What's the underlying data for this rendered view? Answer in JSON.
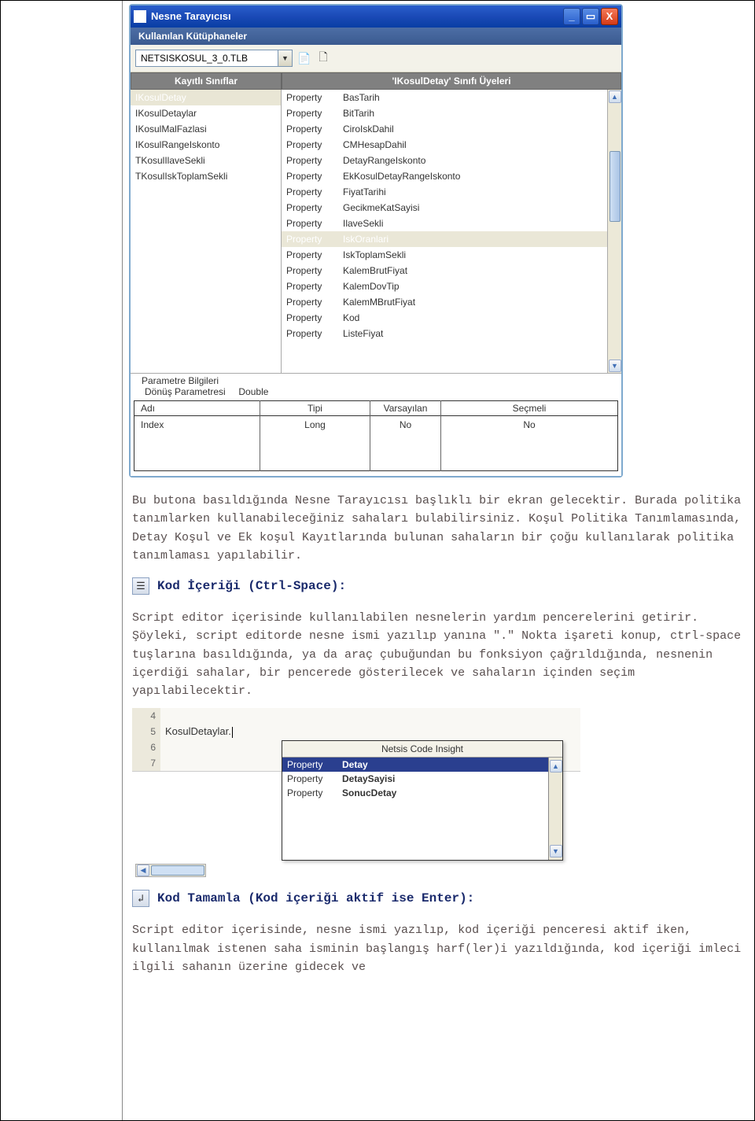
{
  "window": {
    "title": "Nesne Tarayıcısı",
    "subheader": "Kullanılan Kütüphaneler",
    "library_value": "NETSISKOSUL_3_0.TLB",
    "left_col_title": "Kayıtlı Sınıflar",
    "right_col_title": "'IKosulDetay' Sınıfı Üyeleri"
  },
  "classes": [
    {
      "name": "IKosulDetay",
      "selected": true
    },
    {
      "name": "IKosulDetaylar"
    },
    {
      "name": "IKosulMalFazlasi"
    },
    {
      "name": "IKosulRangeIskonto"
    },
    {
      "name": "TKosulIlaveSekli"
    },
    {
      "name": "TKosulIskToplamSekli"
    }
  ],
  "members": [
    {
      "kind": "Property",
      "name": "BasTarih"
    },
    {
      "kind": "Property",
      "name": "BitTarih"
    },
    {
      "kind": "Property",
      "name": "CiroIskDahil"
    },
    {
      "kind": "Property",
      "name": "CMHesapDahil"
    },
    {
      "kind": "Property",
      "name": "DetayRangeIskonto"
    },
    {
      "kind": "Property",
      "name": "EkKosulDetayRangeIskonto"
    },
    {
      "kind": "Property",
      "name": "FiyatTarihi"
    },
    {
      "kind": "Property",
      "name": "GecikmeKatSayisi"
    },
    {
      "kind": "Property",
      "name": "IlaveSekli"
    },
    {
      "kind": "Property",
      "name": "IskOranlari",
      "selected": true
    },
    {
      "kind": "Property",
      "name": "IskToplamSekli"
    },
    {
      "kind": "Property",
      "name": "KalemBrutFiyat"
    },
    {
      "kind": "Property",
      "name": "KalemDovTip"
    },
    {
      "kind": "Property",
      "name": "KalemMBrutFiyat"
    },
    {
      "kind": "Property",
      "name": "Kod"
    },
    {
      "kind": "Property",
      "name": "ListeFiyat"
    }
  ],
  "param_panel": {
    "title": "Parametre Bilgileri",
    "return_label": "Dönüş Parametresi",
    "return_type": "Double",
    "headers": {
      "adi": "Adı",
      "tipi": "Tipi",
      "varsayilan": "Varsayılan",
      "secmeli": "Seçmeli"
    },
    "rows": [
      {
        "adi": "Index",
        "tipi": "Long",
        "varsayilan": "No",
        "secmeli": "No"
      }
    ]
  },
  "doc": {
    "p1": "Bu butona basıldığında Nesne Tarayıcısı başlıklı bir ekran gelecektir. Burada politika tanımlarken kullanabileceğiniz sahaları bulabilirsiniz. Koşul Politika Tanımlamasında, Detay Koşul ve Ek koşul Kayıtlarında bulunan sahaların bir çoğu kullanılarak politika tanımlaması yapılabilir.",
    "h1": "Kod İçeriği (Ctrl-Space):",
    "p2": "Script editor içerisinde kullanılabilen nesnelerin yardım pencerelerini getirir. Şöyleki, script editorde nesne ismi yazılıp yanına \".\" Nokta işareti konup, ctrl-space tuşlarına basıldığında, ya da araç çubuğundan bu fonksiyon çağrıldığında, nesnenin içerdiği sahalar, bir pencerede gösterilecek ve sahaların içinden seçim yapılabilecektir.",
    "h2": "Kod Tamamla (Kod içeriği aktif ise Enter):",
    "p3": "Script editor içerisinde, nesne ismi yazılıp, kod içeriği penceresi aktif iken, kullanılmak istenen saha isminin başlangış harf(ler)i yazıldığında, kod içeriği imleci ilgili sahanın üzerine gidecek ve"
  },
  "insight": {
    "gutter": [
      "4",
      "5",
      "6",
      "7"
    ],
    "code_line": "KosulDetaylar.",
    "popup_title": "Netsis Code Insight",
    "items": [
      {
        "kind": "Property",
        "name": "Detay",
        "selected": true
      },
      {
        "kind": "Property",
        "name": "DetaySayisi"
      },
      {
        "kind": "Property",
        "name": "SonucDetay"
      }
    ]
  }
}
